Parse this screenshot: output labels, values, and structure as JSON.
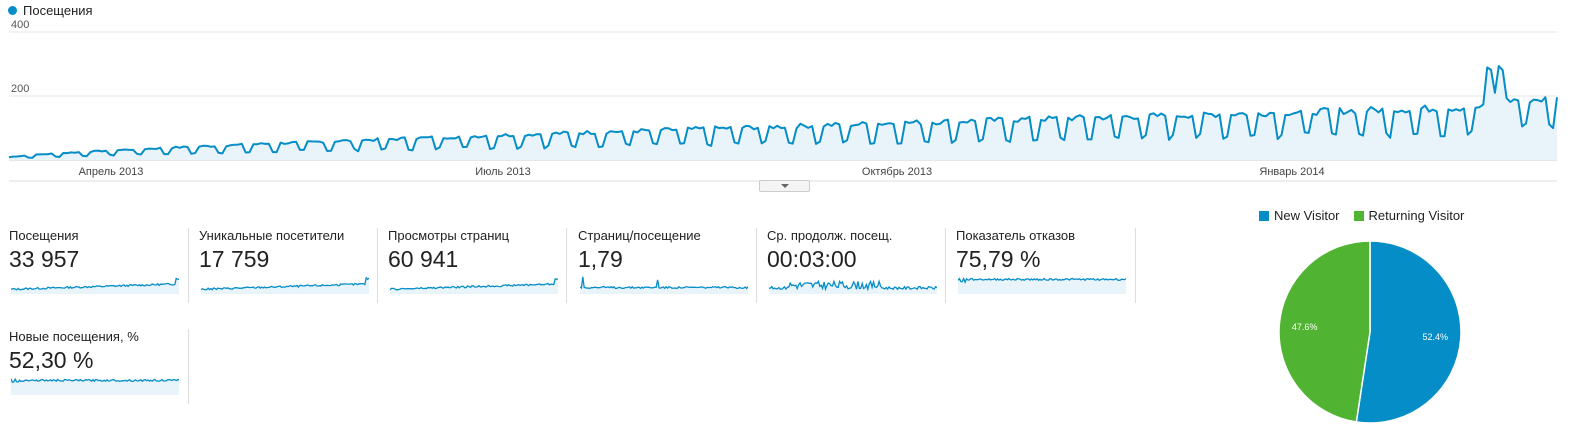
{
  "main_legend": {
    "label": "Посещения"
  },
  "colors": {
    "line": "#058dc7",
    "fill": "#e8f4fa",
    "grid": "#e4e4e4",
    "new": "#058dc7",
    "returning": "#50b432"
  },
  "chart_data": [
    {
      "type": "area",
      "series": [
        {
          "name": "Посещения"
        }
      ],
      "yticks": [
        "400",
        "200"
      ],
      "ylim": [
        0,
        400
      ],
      "xticks": [
        "Апрель 2013",
        "Июль 2013",
        "Октябрь 2013",
        "Январь 2014"
      ],
      "grid": true
    },
    {
      "type": "pie",
      "legend": [
        "New Visitor",
        "Returning Visitor"
      ],
      "slices": [
        {
          "name": "New Visitor",
          "value": 52.4,
          "label": "52.4%"
        },
        {
          "name": "Returning Visitor",
          "value": 47.6,
          "label": "47.6%"
        }
      ]
    }
  ],
  "metrics": [
    {
      "label": "Посещения",
      "value": "33 957"
    },
    {
      "label": "Уникальные посетители",
      "value": "17 759"
    },
    {
      "label": "Просмотры страниц",
      "value": "60 941"
    },
    {
      "label": "Страниц/посещение",
      "value": "1,79"
    },
    {
      "label": "Ср. продолж. посещ.",
      "value": "00:03:00"
    },
    {
      "label": "Показатель отказов",
      "value": "75,79 %"
    },
    {
      "label": "Новые посещения, %",
      "value": "52,30 %"
    }
  ]
}
